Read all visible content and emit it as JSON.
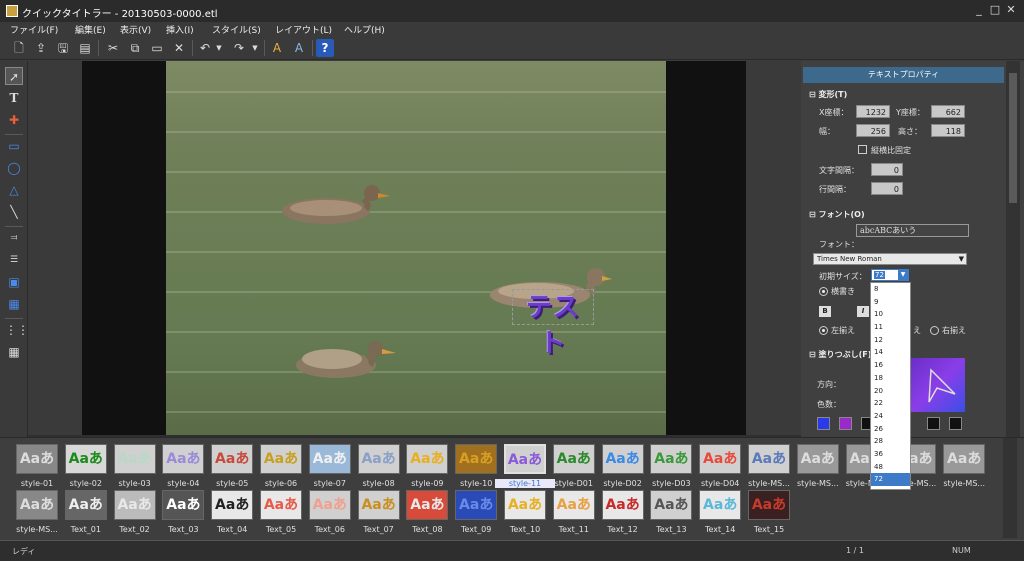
{
  "window": {
    "title": "クイックタイトラー - 20130503-0000.etl",
    "controls": [
      "_",
      "□",
      "✕"
    ]
  },
  "menu": [
    "ファイル(F)",
    "編集(E)",
    "表示(V)",
    "挿入(I)",
    "スタイル(S)",
    "レイアウト(L)",
    "ヘルプ(H)"
  ],
  "toolbar": {
    "icons": [
      "new-icon",
      "open-icon",
      "save-icon",
      "save-as-icon",
      "cut-icon",
      "copy-icon",
      "paste-icon",
      "delete-icon",
      "undo-icon",
      "redo-icon",
      "text-style-icon",
      "text-effect-icon",
      "help-icon"
    ]
  },
  "lefttools": [
    "select-arrow-icon",
    "text-tool-icon",
    "crosshair-icon",
    "rectangle-icon",
    "ellipse-icon",
    "triangle-icon",
    "line-icon",
    "align-left-icon",
    "align-center-icon",
    "align-right-icon",
    "distribute-icon",
    "grid-icon",
    "grid-small-icon"
  ],
  "canvas": {
    "test_text": "テスト"
  },
  "panel": {
    "header": "テキストプロパティ",
    "transform": {
      "title": "変形(T)",
      "x_label": "X座標：",
      "x": "1232",
      "y_label": "Y座標：",
      "y": "662",
      "w_label": "幅：",
      "w": "256",
      "h_label": "高さ：",
      "h": "118",
      "aspect_label": "縦横比固定",
      "char_spacing_label": "文字間隔：",
      "char_spacing": "0",
      "line_spacing_label": "行間隔：",
      "line_spacing": "0"
    },
    "font": {
      "title": "フォント(O)",
      "sample": "abcABCあいう",
      "font_label": "フォント：",
      "font_name": "Times New Roman",
      "size_label": "初期サイズ：",
      "size": "72",
      "horizontal_label": "横書き",
      "bold": "B",
      "italic": "I",
      "align_left": "左揃え",
      "align_center_partial": "え",
      "align_right": "右揃え"
    },
    "fill": {
      "title": "塗りつぶし(F)",
      "direction_label": "方向：",
      "color_count_label": "色数："
    }
  },
  "size_options": [
    "8",
    "9",
    "10",
    "11",
    "12",
    "14",
    "16",
    "18",
    "20",
    "22",
    "24",
    "26",
    "28",
    "36",
    "48",
    "72"
  ],
  "styles_row1": [
    {
      "label": "style-01",
      "fg": "#ddd",
      "bg": "#888"
    },
    {
      "label": "style-02",
      "fg": "#1a8a1a",
      "bg": "#d8d8d8"
    },
    {
      "label": "style-03",
      "fg": "#b8d8c8",
      "bg": "#d0d0d0"
    },
    {
      "label": "style-04",
      "fg": "#9a8ad8",
      "bg": "#d0d0d0"
    },
    {
      "label": "style-05",
      "fg": "#c84a3a",
      "bg": "#d0d0d0"
    },
    {
      "label": "style-06",
      "fg": "#c8a020",
      "bg": "#d0d0d0"
    },
    {
      "label": "style-07",
      "fg": "#f0f0f0",
      "bg": "#9ab8d8"
    },
    {
      "label": "style-08",
      "fg": "#8aa0c8",
      "bg": "#d0d0d0"
    },
    {
      "label": "style-09",
      "fg": "#e8b020",
      "bg": "#d0d0d0"
    },
    {
      "label": "style-10",
      "fg": "#d8a020",
      "bg": "#a07020"
    },
    {
      "label": "style-11",
      "fg": "#8a5ad8",
      "bg": "#d0d0d0"
    },
    {
      "label": "style-D01",
      "fg": "#2a8a2a",
      "bg": "#d0d0d0"
    },
    {
      "label": "style-D02",
      "fg": "#3a8ae8",
      "bg": "#d0d0d0"
    },
    {
      "label": "style-D03",
      "fg": "#3a9a3a",
      "bg": "#d0d0d0"
    },
    {
      "label": "style-D04",
      "fg": "#e84a3a",
      "bg": "#d0d0d0"
    },
    {
      "label": "style-MS...",
      "fg": "#5a7ab8",
      "bg": "#d0d0d0"
    },
    {
      "label": "style-MS...",
      "fg": "#ddd",
      "bg": "#999"
    },
    {
      "label": "style-MS...",
      "fg": "#ddd",
      "bg": "#999"
    },
    {
      "label": "style-MS...",
      "fg": "#ddd",
      "bg": "#999"
    },
    {
      "label": "style-MS...",
      "fg": "#ddd",
      "bg": "#999"
    }
  ],
  "styles_row2": [
    {
      "label": "style-MS...",
      "fg": "#ddd",
      "bg": "#888"
    },
    {
      "label": "Text_01",
      "fg": "#eee",
      "bg": "#666"
    },
    {
      "label": "Text_02",
      "fg": "#e8e8e8",
      "bg": "#bbb"
    },
    {
      "label": "Text_03",
      "fg": "#fff",
      "bg": "#555"
    },
    {
      "label": "Text_04",
      "fg": "#222",
      "bg": "#e8e8e8"
    },
    {
      "label": "Text_05",
      "fg": "#e85a4a",
      "bg": "#e8e8e8"
    },
    {
      "label": "Text_06",
      "fg": "#f0a090",
      "bg": "#d0d0d0"
    },
    {
      "label": "Text_07",
      "fg": "#c89020",
      "bg": "#d0d0d0"
    },
    {
      "label": "Text_08",
      "fg": "#e8e8e8",
      "bg": "#d84a3a"
    },
    {
      "label": "Text_09",
      "fg": "#6a8ae8",
      "bg": "#2a4ab8"
    },
    {
      "label": "Text_10",
      "fg": "#e8b020",
      "bg": "#e8e8e8"
    },
    {
      "label": "Text_11",
      "fg": "#e8a040",
      "bg": "#e8e8e8"
    },
    {
      "label": "Text_12",
      "fg": "#c82a2a",
      "bg": "#e8e8e8"
    },
    {
      "label": "Text_13",
      "fg": "#555",
      "bg": "#d0d0d0"
    },
    {
      "label": "Text_14",
      "fg": "#5ab8d8",
      "bg": "#e8e8e8"
    },
    {
      "label": "Text_15",
      "fg": "#c83a2a",
      "bg": "#3a2020"
    }
  ],
  "style_sample": "Aaあ",
  "status": {
    "left": "レディ",
    "page": "1 / 1",
    "num": "NUM"
  }
}
